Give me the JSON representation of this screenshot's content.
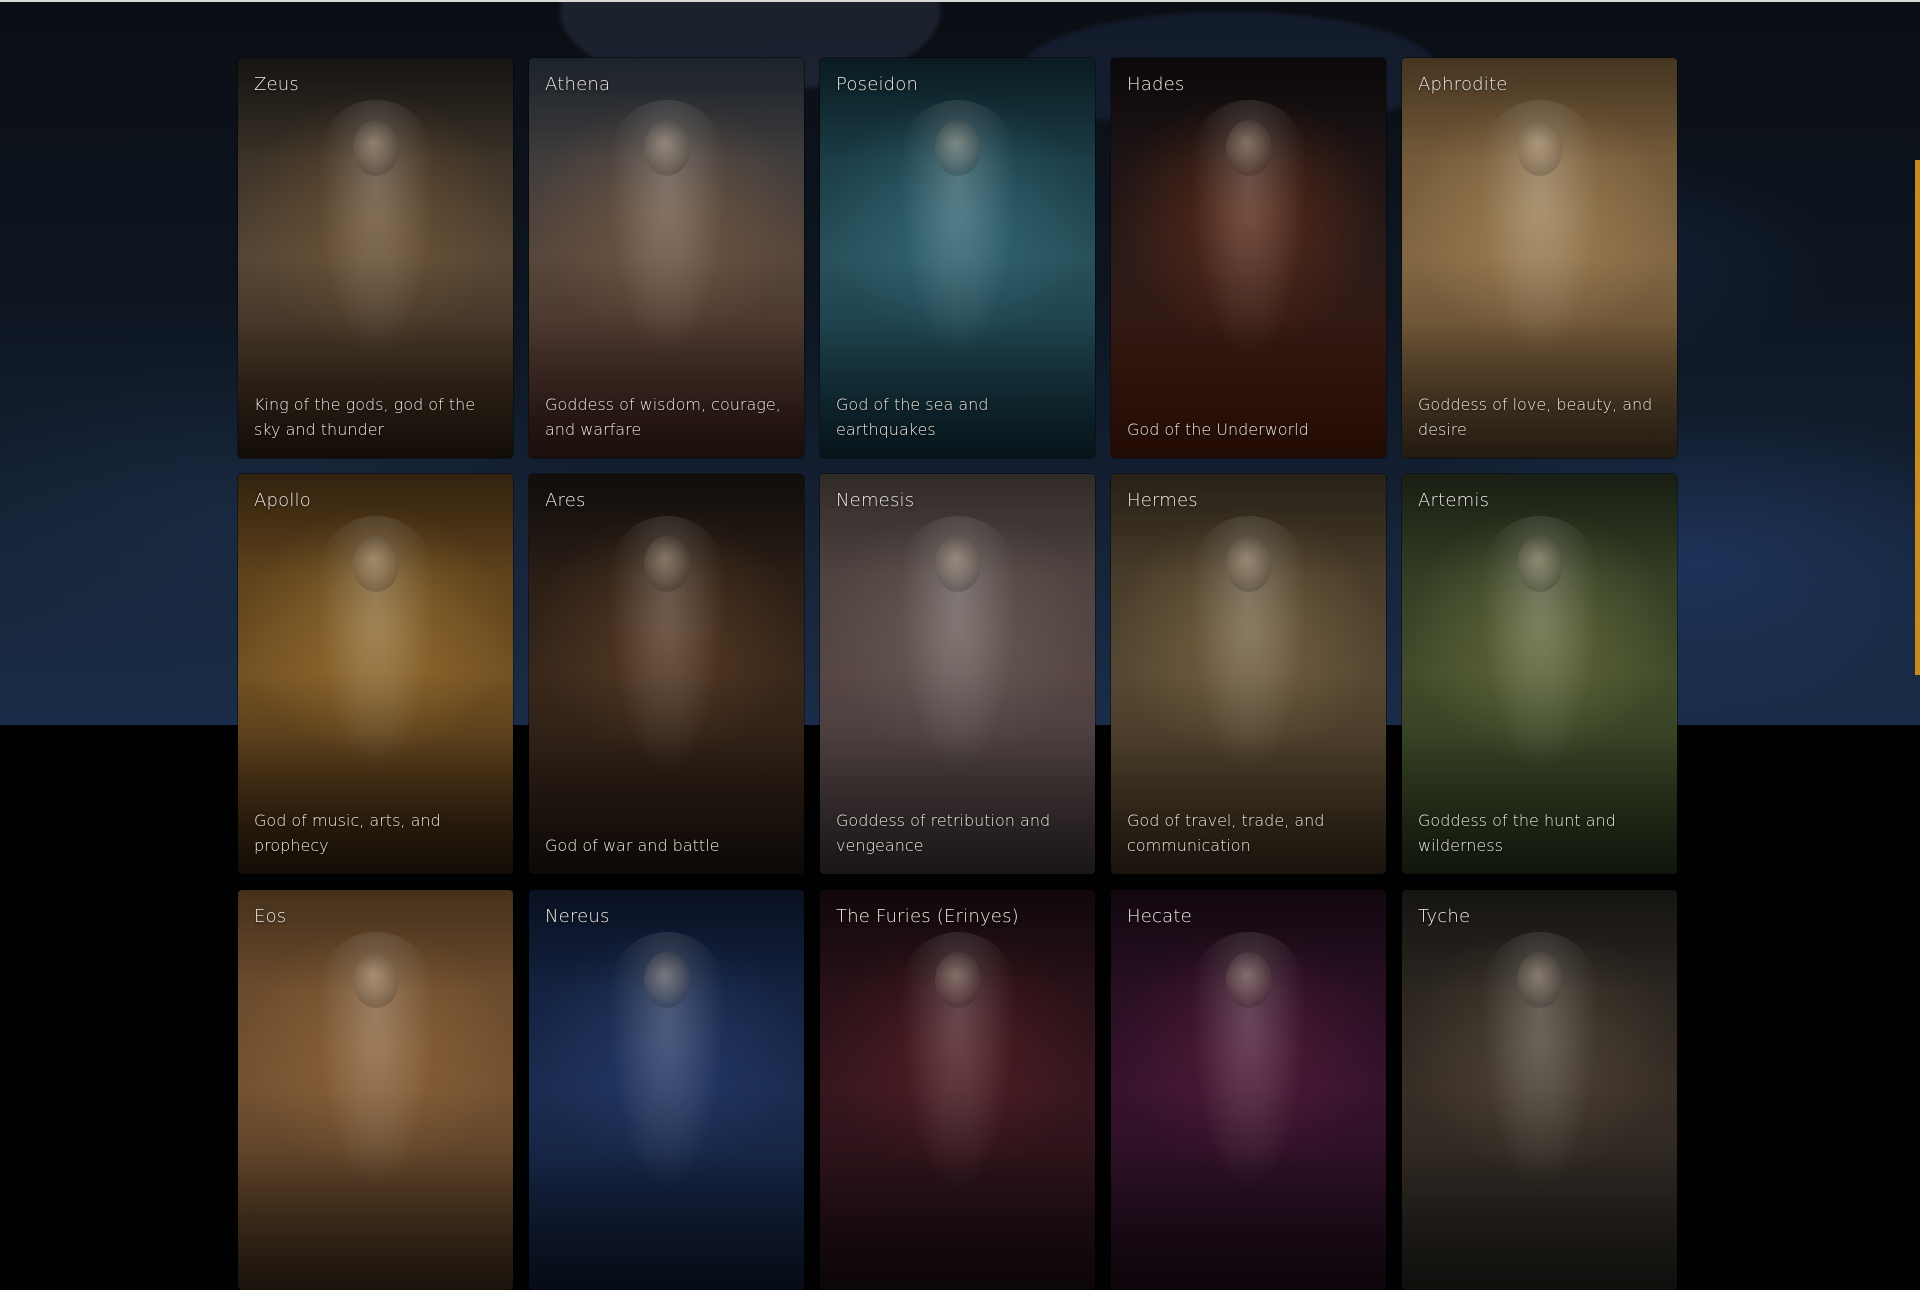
{
  "gods": [
    {
      "name": "Zeus",
      "description": "King of the gods, god of the sky and thunder",
      "palette": {
        "top": "#23201c",
        "mid": "#5a4a38",
        "bottom": "#2a1c10",
        "glow": "#b27a3e"
      }
    },
    {
      "name": "Athena",
      "description": "Goddess of wisdom, courage, and warfare",
      "palette": {
        "top": "#2b3540",
        "mid": "#5c4a3e",
        "bottom": "#3a1e18",
        "glow": "#b58455"
      }
    },
    {
      "name": "Poseidon",
      "description": "God of the sea and earthquakes",
      "palette": {
        "top": "#0f2a33",
        "mid": "#2a5560",
        "bottom": "#0e2c38",
        "glow": "#4fa3b8"
      }
    },
    {
      "name": "Hades",
      "description": "God of the Underworld",
      "palette": {
        "top": "#120e10",
        "mid": "#2c1c1a",
        "bottom": "#4a1808",
        "glow": "#d0541c"
      }
    },
    {
      "name": "Aphrodite",
      "description": "Goddess of love, beauty, and desire",
      "palette": {
        "top": "#6a5232",
        "mid": "#8a6c46",
        "bottom": "#4d3a24",
        "glow": "#e3c184"
      }
    },
    {
      "name": "Apollo",
      "description": "God of music, arts, and prophecy",
      "palette": {
        "top": "#4d3516",
        "mid": "#7a5624",
        "bottom": "#2a1a0c",
        "glow": "#e6b455"
      }
    },
    {
      "name": "Ares",
      "description": "God of war and battle",
      "palette": {
        "top": "#1a1410",
        "mid": "#3c2a1c",
        "bottom": "#1e140e",
        "glow": "#a0663a"
      }
    },
    {
      "name": "Nemesis",
      "description": "Goddess of retribution and vengeance",
      "palette": {
        "top": "#4b423e",
        "mid": "#5a4a48",
        "bottom": "#3a3033",
        "glow": "#9b8c86"
      }
    },
    {
      "name": "Hermes",
      "description": "God of travel, trade, and communication",
      "palette": {
        "top": "#3c3222",
        "mid": "#5a4b34",
        "bottom": "#3a2c1c",
        "glow": "#c7a66a"
      }
    },
    {
      "name": "Artemis",
      "description": "Goddess of the hunt and wilderness",
      "palette": {
        "top": "#26301e",
        "mid": "#45502c",
        "bottom": "#24301a",
        "glow": "#b4b26a"
      }
    },
    {
      "name": "Eos",
      "description": "",
      "palette": {
        "top": "#6a4a2a",
        "mid": "#7a5634",
        "bottom": "#3a2a1a",
        "glow": "#c99050"
      }
    },
    {
      "name": "Nereus",
      "description": "",
      "palette": {
        "top": "#0e1a33",
        "mid": "#1c2e55",
        "bottom": "#0e1a30",
        "glow": "#3c5aa0"
      }
    },
    {
      "name": "The Furies (Erinyes)",
      "description": "",
      "palette": {
        "top": "#1a0c10",
        "mid": "#3a1820",
        "bottom": "#1a0c10",
        "glow": "#8a2a30"
      }
    },
    {
      "name": "Hecate",
      "description": "",
      "palette": {
        "top": "#1c0c18",
        "mid": "#3a1430",
        "bottom": "#1c0c18",
        "glow": "#8a2a4a"
      }
    },
    {
      "name": "Tyche",
      "description": "",
      "palette": {
        "top": "#22201c",
        "mid": "#3a3028",
        "bottom": "#22201c",
        "glow": "#8a7a5a"
      }
    }
  ]
}
